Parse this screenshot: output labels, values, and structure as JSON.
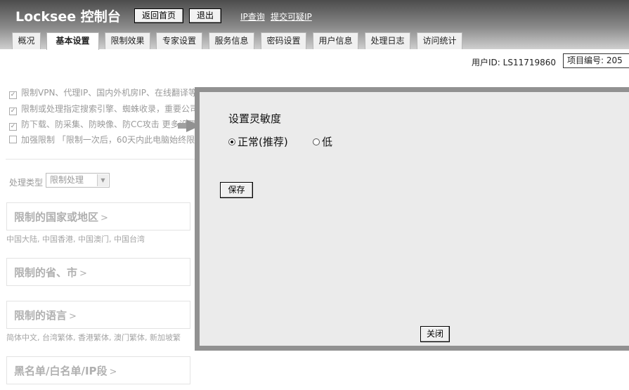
{
  "header": {
    "brand": "Locksee 控制台",
    "home_button": "返回首页",
    "logout_button": "退出",
    "ip_query_link": "IP查询",
    "submit_ip_link": "提交可疑IP"
  },
  "tabs": [
    {
      "label": "概况"
    },
    {
      "label": "基本设置",
      "active": true
    },
    {
      "label": "限制效果"
    },
    {
      "label": "专家设置"
    },
    {
      "label": "服务信息"
    },
    {
      "label": "密码设置"
    },
    {
      "label": "用户信息"
    },
    {
      "label": "处理日志"
    },
    {
      "label": "访问统计"
    }
  ],
  "info": {
    "user_id": "用户ID:  LS11719860",
    "project_no": "项目编号: 205"
  },
  "options": [
    {
      "checked": true,
      "text": "限制VPN、代理IP、国内外机房IP、在线翻译等"
    },
    {
      "checked": true,
      "text": "限制或处理指定搜索引擎、蜘蛛收录，重要公司"
    },
    {
      "checked": true,
      "text": "防下载、防采集、防映像、防CC攻击   更多设置"
    },
    {
      "checked": false,
      "text": "加强限制 「限制一次后，60天内此电脑始终限"
    }
  ],
  "process": {
    "label": "处理类型",
    "selected": "限制处理"
  },
  "panels": [
    {
      "title": "限制的国家或地区",
      "sub": "中国大陆, 中国香港, 中国澳门, 中国台湾"
    },
    {
      "title": "限制的省、市",
      "sub": ""
    },
    {
      "title": "限制的语言",
      "sub": "简体中文, 台湾繁体, 香港繁体, 澳门繁体, 新加坡繁"
    },
    {
      "title": "黑名单/白名单/IP段",
      "sub": ""
    }
  ],
  "gt": ">",
  "modal": {
    "title": "设置灵敏度",
    "radio_normal": "正常(推荐)",
    "radio_low": "低",
    "selected": "normal",
    "save_button": "保存",
    "close_button": "关闭"
  },
  "colors": {
    "header_top": "#4c4c4c",
    "modal_border": "#919191",
    "modal_bg": "#ebebeb"
  }
}
